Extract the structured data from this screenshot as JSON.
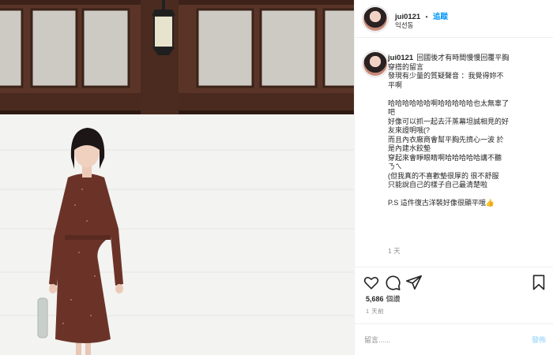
{
  "header": {
    "username": "jui0121",
    "dot": "•",
    "follow_label": "追蹤",
    "location": "익선동"
  },
  "caption": {
    "username": "jui0121",
    "text": "回國後才有時間慢慢回覆平胸\n穿搭的留言\n發現有少量的質疑聲音 ：我覺得妳不\n平啊\n\n哈哈哈哈哈哈啊哈哈哈哈哈也太無辜了\n吧\n好像可以抓一起去汗蒸幕坦誠相見的好\n友來證明哦(?\n而且內衣廠商會幫平胸先擠心一波 於\n是內建水餃墊\n穿起來會睜眼睛啊哈哈哈哈哈講不聽\nㄋㄟ\n(但我真的不喜歡墊很厚的 很不舒服\n只能說自己的樣子自己最清楚啦\n\nP.S 這件復古洋裝好像很顯平哦👍",
    "time": "1 天"
  },
  "stats": {
    "views_value": "5,686",
    "views_unit": "個讚",
    "ago": "1 天前"
  },
  "comment": {
    "placeholder": "留言......",
    "post_label": "發佈"
  },
  "icons": {
    "like": "heart-icon",
    "comment": "comment-icon",
    "share": "share-icon",
    "save": "bookmark-icon"
  },
  "colors": {
    "link": "#0095f6",
    "post_disabled": "#b2dffc",
    "meta": "#8e8e8e"
  }
}
